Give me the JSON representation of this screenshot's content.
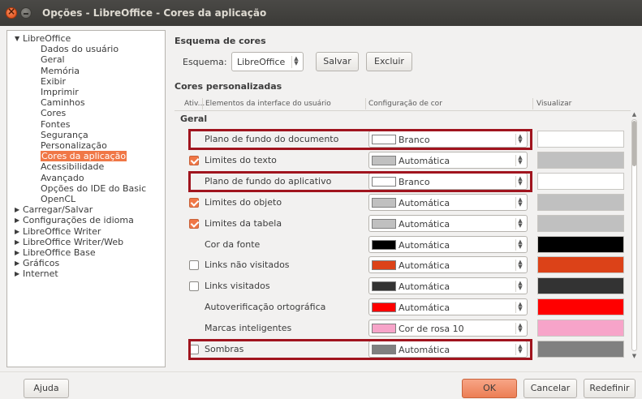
{
  "window": {
    "title": "Opções - LibreOffice - Cores da aplicação"
  },
  "tree": {
    "items": [
      {
        "label": "LibreOffice",
        "level": 0,
        "expanded": true
      },
      {
        "label": "Dados do usuário",
        "level": 1
      },
      {
        "label": "Geral",
        "level": 1
      },
      {
        "label": "Memória",
        "level": 1
      },
      {
        "label": "Exibir",
        "level": 1
      },
      {
        "label": "Imprimir",
        "level": 1
      },
      {
        "label": "Caminhos",
        "level": 1
      },
      {
        "label": "Cores",
        "level": 1
      },
      {
        "label": "Fontes",
        "level": 1
      },
      {
        "label": "Segurança",
        "level": 1
      },
      {
        "label": "Personalização",
        "level": 1
      },
      {
        "label": "Cores da aplicação",
        "level": 1,
        "selected": true
      },
      {
        "label": "Acessibilidade",
        "level": 1
      },
      {
        "label": "Avançado",
        "level": 1
      },
      {
        "label": "Opções do IDE do Basic",
        "level": 1
      },
      {
        "label": "OpenCL",
        "level": 1
      },
      {
        "label": "Carregar/Salvar",
        "level": 0,
        "expanded": false
      },
      {
        "label": "Configurações de idioma",
        "level": 0,
        "expanded": false
      },
      {
        "label": "LibreOffice Writer",
        "level": 0,
        "expanded": false
      },
      {
        "label": "LibreOffice Writer/Web",
        "level": 0,
        "expanded": false
      },
      {
        "label": "LibreOffice Base",
        "level": 0,
        "expanded": false
      },
      {
        "label": "Gráficos",
        "level": 0,
        "expanded": false
      },
      {
        "label": "Internet",
        "level": 0,
        "expanded": false
      }
    ]
  },
  "scheme": {
    "section_title": "Esquema de cores",
    "label": "Esquema:",
    "value": "LibreOffice",
    "save_button": "Salvar",
    "delete_button": "Excluir"
  },
  "custom_colors": {
    "section_title": "Cores personalizadas",
    "headers": {
      "active": "Ativ...",
      "element": "Elementos da interface do usuário",
      "color": "Configuração de cor",
      "preview": "Visualizar"
    },
    "group": "Geral",
    "rows": [
      {
        "name": "Plano de fundo do documento",
        "checkbox": null,
        "color_name": "Branco",
        "color": "#ffffff",
        "highlighted": true
      },
      {
        "name": "Limites do texto",
        "checkbox": true,
        "color_name": "Automática",
        "color": "#c0c0c0",
        "highlighted": false
      },
      {
        "name": "Plano de fundo do aplicativo",
        "checkbox": null,
        "color_name": "Branco",
        "color": "#ffffff",
        "highlighted": true
      },
      {
        "name": "Limites do objeto",
        "checkbox": true,
        "color_name": "Automática",
        "color": "#c0c0c0",
        "highlighted": false
      },
      {
        "name": "Limites da tabela",
        "checkbox": true,
        "color_name": "Automática",
        "color": "#c0c0c0",
        "highlighted": false
      },
      {
        "name": "Cor da fonte",
        "checkbox": null,
        "color_name": "Automática",
        "color": "#000000",
        "highlighted": false
      },
      {
        "name": "Links não visitados",
        "checkbox": false,
        "color_name": "Automática",
        "color": "#dc4218",
        "highlighted": false
      },
      {
        "name": "Links visitados",
        "checkbox": false,
        "color_name": "Automática",
        "color": "#333333",
        "highlighted": false
      },
      {
        "name": "Autoverificação ortográfica",
        "checkbox": null,
        "color_name": "Automática",
        "color": "#ff0000",
        "highlighted": false
      },
      {
        "name": "Marcas inteligentes",
        "checkbox": null,
        "color_name": "Cor de rosa 10",
        "color": "#f7a4c9",
        "highlighted": false
      },
      {
        "name": "Sombras",
        "checkbox": false,
        "color_name": "Automática",
        "color": "#808080",
        "highlighted": true
      }
    ]
  },
  "footer": {
    "help_button": "Ajuda",
    "ok_button": "OK",
    "cancel_button": "Cancelar",
    "reset_button": "Redefinir"
  },
  "colors": {
    "accent": "#f07746",
    "highlight_box": "#a0141e",
    "titlebar": "#3c3b37"
  }
}
